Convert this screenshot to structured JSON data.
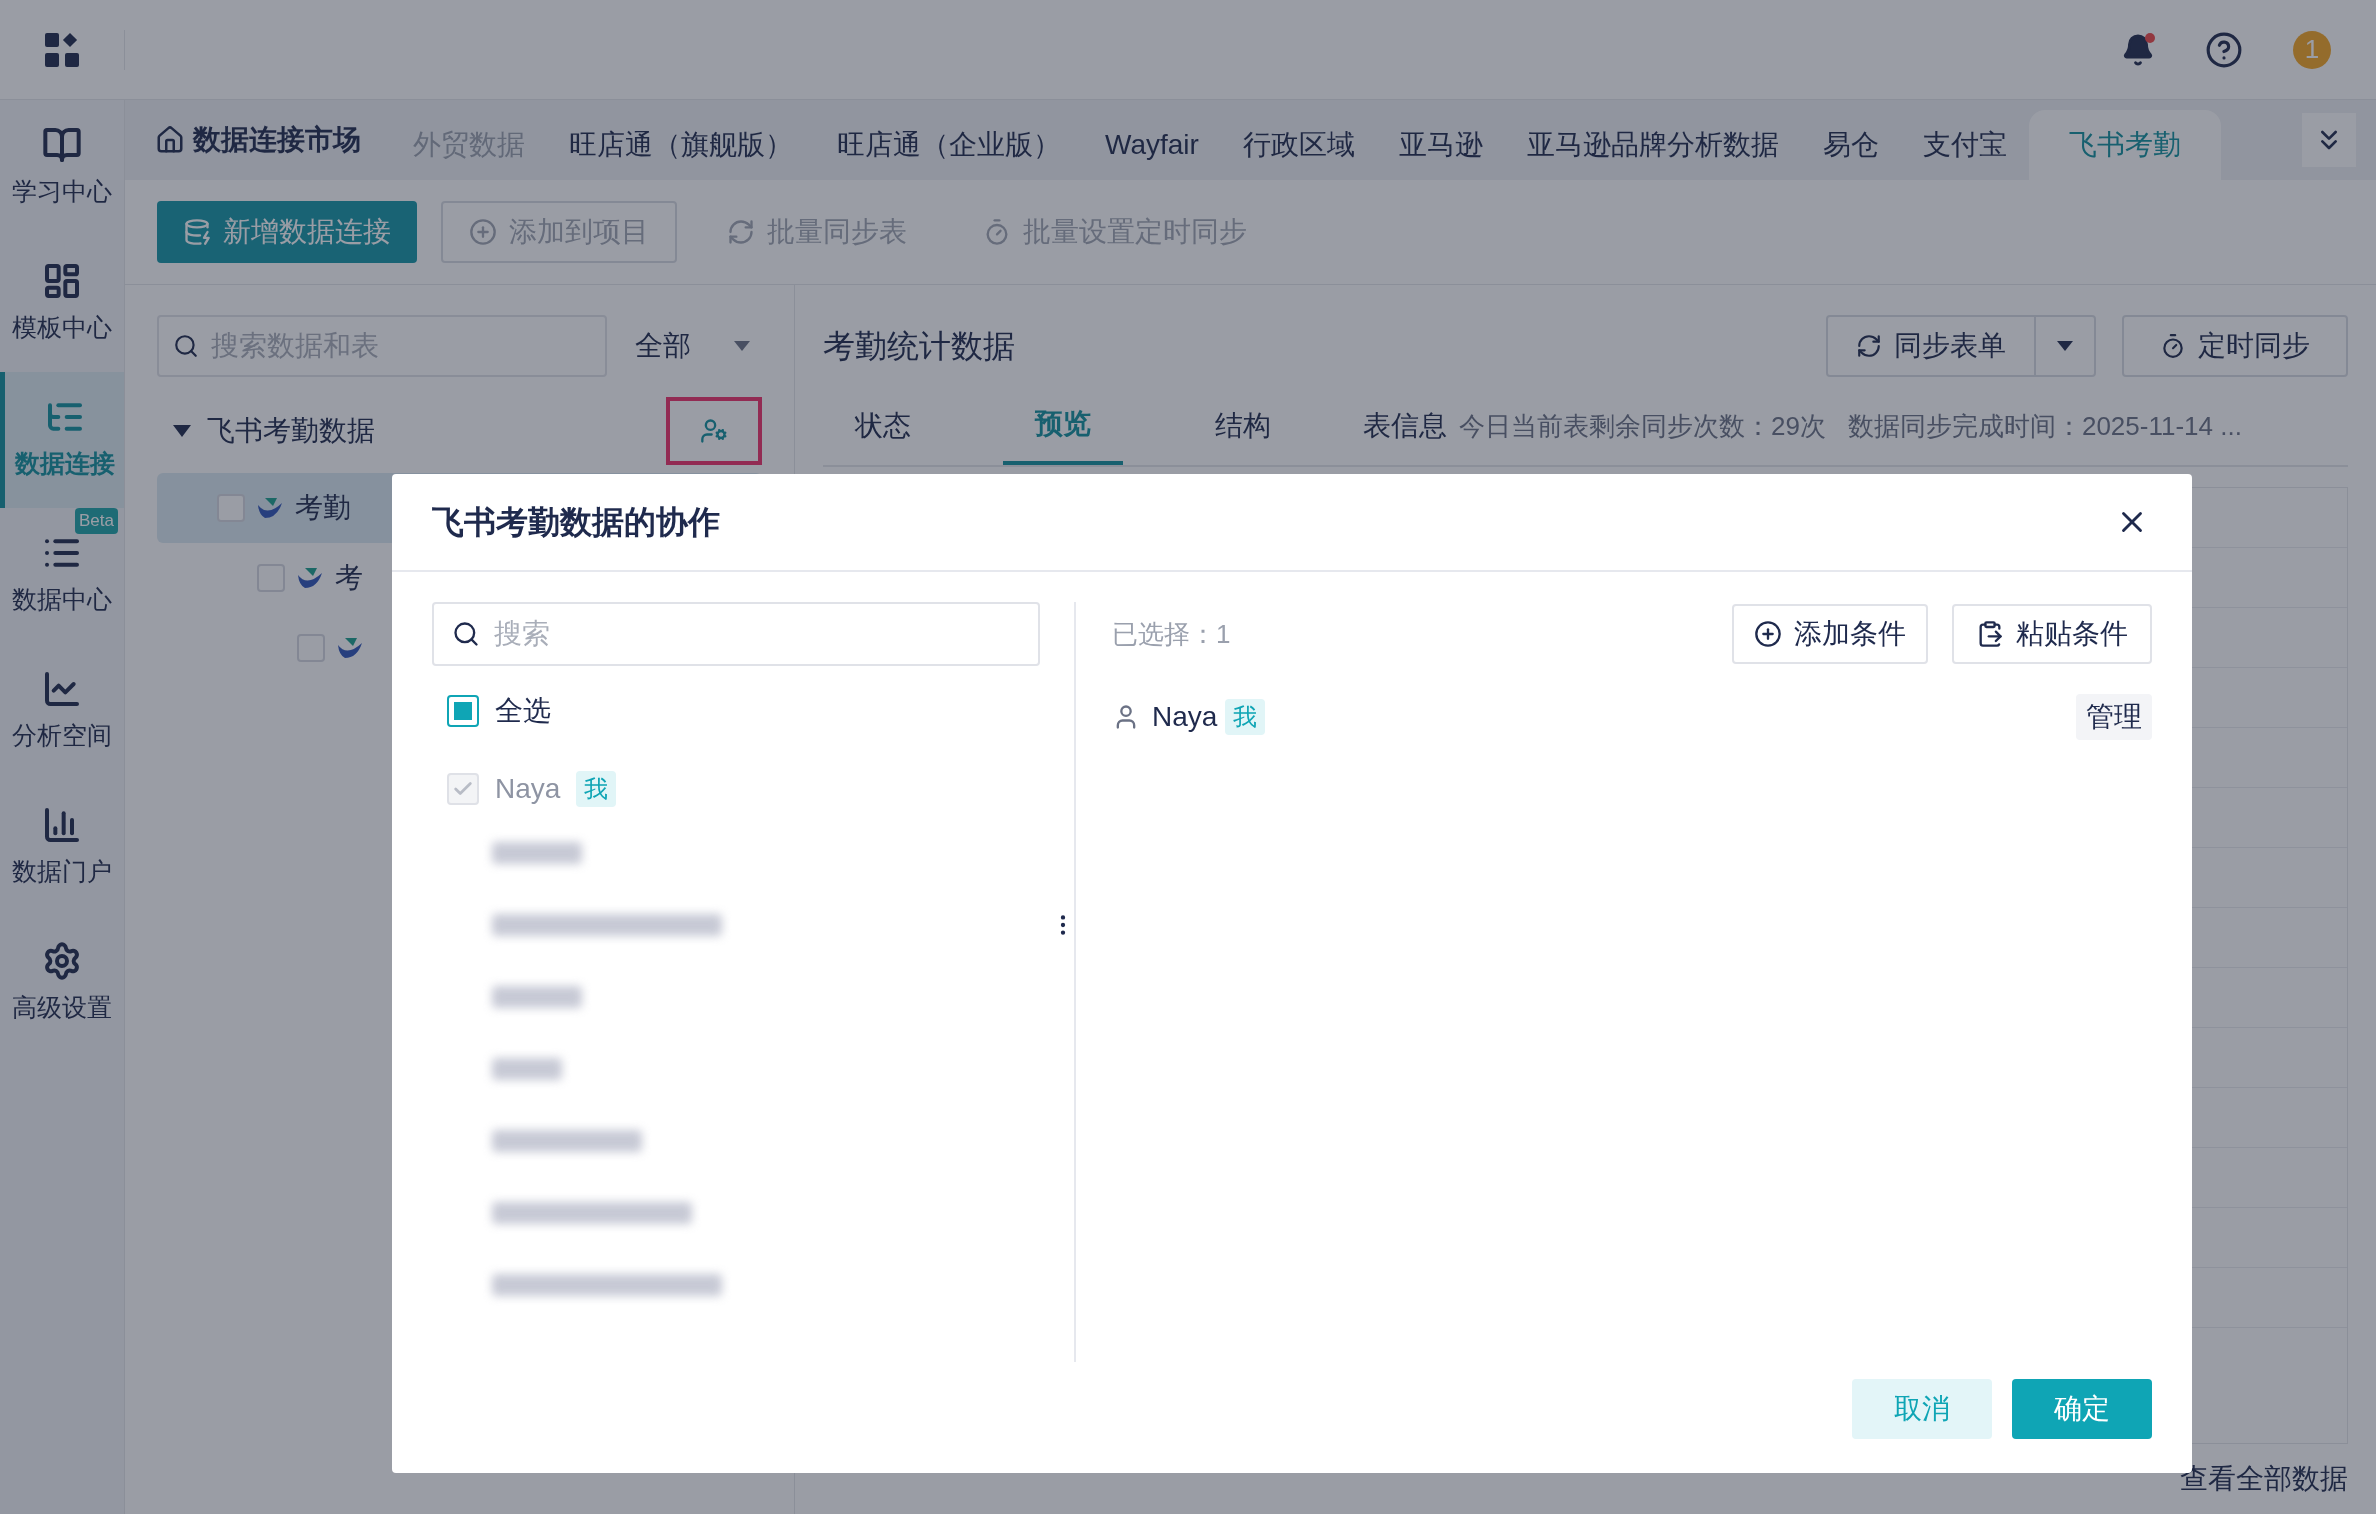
{
  "topbar": {
    "avatar_initial": "1",
    "has_notification": true
  },
  "sidebar": {
    "items": [
      {
        "label": "学习中心",
        "selected": false
      },
      {
        "label": "模板中心",
        "selected": false
      },
      {
        "label": "数据连接",
        "selected": true
      },
      {
        "label": "数据中心",
        "selected": false,
        "badge": "Beta"
      },
      {
        "label": "分析空间",
        "selected": false
      },
      {
        "label": "数据门户",
        "selected": false
      },
      {
        "label": "高级设置",
        "selected": false
      }
    ]
  },
  "tabs": {
    "home": "数据连接市场",
    "items": [
      {
        "label": "外贸数据",
        "selected": false,
        "disabled": true
      },
      {
        "label": "旺店通（旗舰版）",
        "selected": false,
        "disabled": false
      },
      {
        "label": "旺店通（企业版）",
        "selected": false,
        "disabled": false
      },
      {
        "label": "Wayfair",
        "selected": false,
        "disabled": false
      },
      {
        "label": "行政区域",
        "selected": false,
        "disabled": false
      },
      {
        "label": "亚马逊",
        "selected": false,
        "disabled": false
      },
      {
        "label": "亚马逊品牌分析数据",
        "selected": false,
        "disabled": false
      },
      {
        "label": "易仓",
        "selected": false,
        "disabled": false
      },
      {
        "label": "支付宝",
        "selected": false,
        "disabled": false
      },
      {
        "label": "飞书考勤",
        "selected": true,
        "disabled": false
      }
    ]
  },
  "toolbar": {
    "buttons": [
      {
        "label": "新增数据连接",
        "kind": "primary"
      },
      {
        "label": "添加到项目",
        "kind": "outline"
      },
      {
        "label": "批量同步表",
        "kind": "text"
      },
      {
        "label": "批量设置定时同步",
        "kind": "text"
      }
    ]
  },
  "left_panel": {
    "search": {
      "placeholder": "搜索数据和表"
    },
    "filter": "全部",
    "tree": {
      "label": "飞书考勤数据",
      "expanded": true,
      "highlighted": true,
      "children": [
        {
          "label": "考勤",
          "selected": true,
          "children": [
            {
              "label": "考",
              "selected": false,
              "children": [
                {
                  "selected": false
                }
              ]
            }
          ]
        }
      ]
    }
  },
  "content": {
    "title": "考勤统计数据",
    "sync_button": "同步表单",
    "schedule_button": "定时同步",
    "tabs": [
      {
        "label": "状态",
        "selected": false
      },
      {
        "label": "预览",
        "selected": true
      },
      {
        "label": "结构",
        "selected": false
      }
    ],
    "info_label": "表信息",
    "info": "今日当前表剩余同步次数：29次",
    "sync_time": "数据同步完成时间：2025-11-14 ...",
    "footer_link": "查看全部数据"
  },
  "dialog": {
    "title": "飞书考勤数据的协作",
    "search": {
      "placeholder": "搜索"
    },
    "select_all": {
      "label": "全选",
      "indeterminate": true
    },
    "members": [
      {
        "name": "Naya",
        "tag": "我",
        "checked": true,
        "disabled": true
      }
    ],
    "selected_label": "已选择：1",
    "add_condition": "添加条件",
    "paste_condition": "粘贴条件",
    "selected": [
      {
        "name": "Naya",
        "tag": "我",
        "action": "管理"
      }
    ],
    "cancel": "取消",
    "confirm": "确定"
  }
}
